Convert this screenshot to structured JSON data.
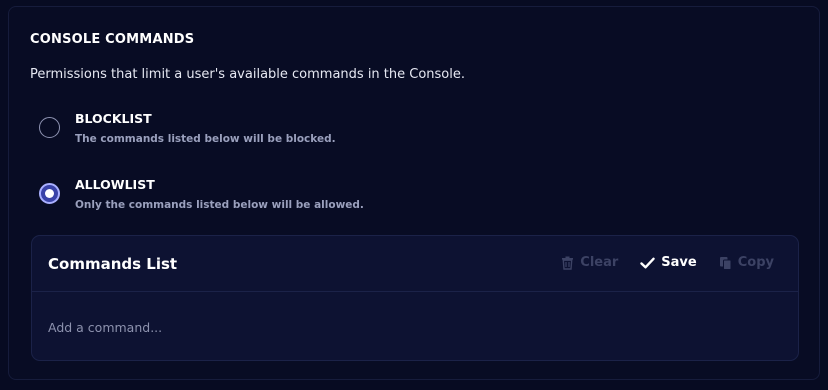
{
  "console": {
    "title": "CONSOLE COMMANDS",
    "description": "Permissions that limit a user's available commands in the Console."
  },
  "options": [
    {
      "title": "BLOCKLIST",
      "description": "The commands listed below will be blocked.",
      "selected": false
    },
    {
      "title": "ALLOWLIST",
      "description": "Only the commands listed below will be allowed.",
      "selected": true
    }
  ],
  "commands_list": {
    "title": "Commands List",
    "actions": {
      "clear": {
        "label": "Clear",
        "icon": "trash-icon",
        "enabled": false
      },
      "save": {
        "label": "Save",
        "icon": "check-icon",
        "enabled": true
      },
      "copy": {
        "label": "Copy",
        "icon": "copy-icon",
        "enabled": false
      }
    },
    "input": {
      "placeholder": "Add a command...",
      "value": ""
    }
  },
  "colors": {
    "background": "#070b22",
    "card": "#0d1232",
    "accent": "#3a43a8",
    "disabled": "#3c4264"
  }
}
